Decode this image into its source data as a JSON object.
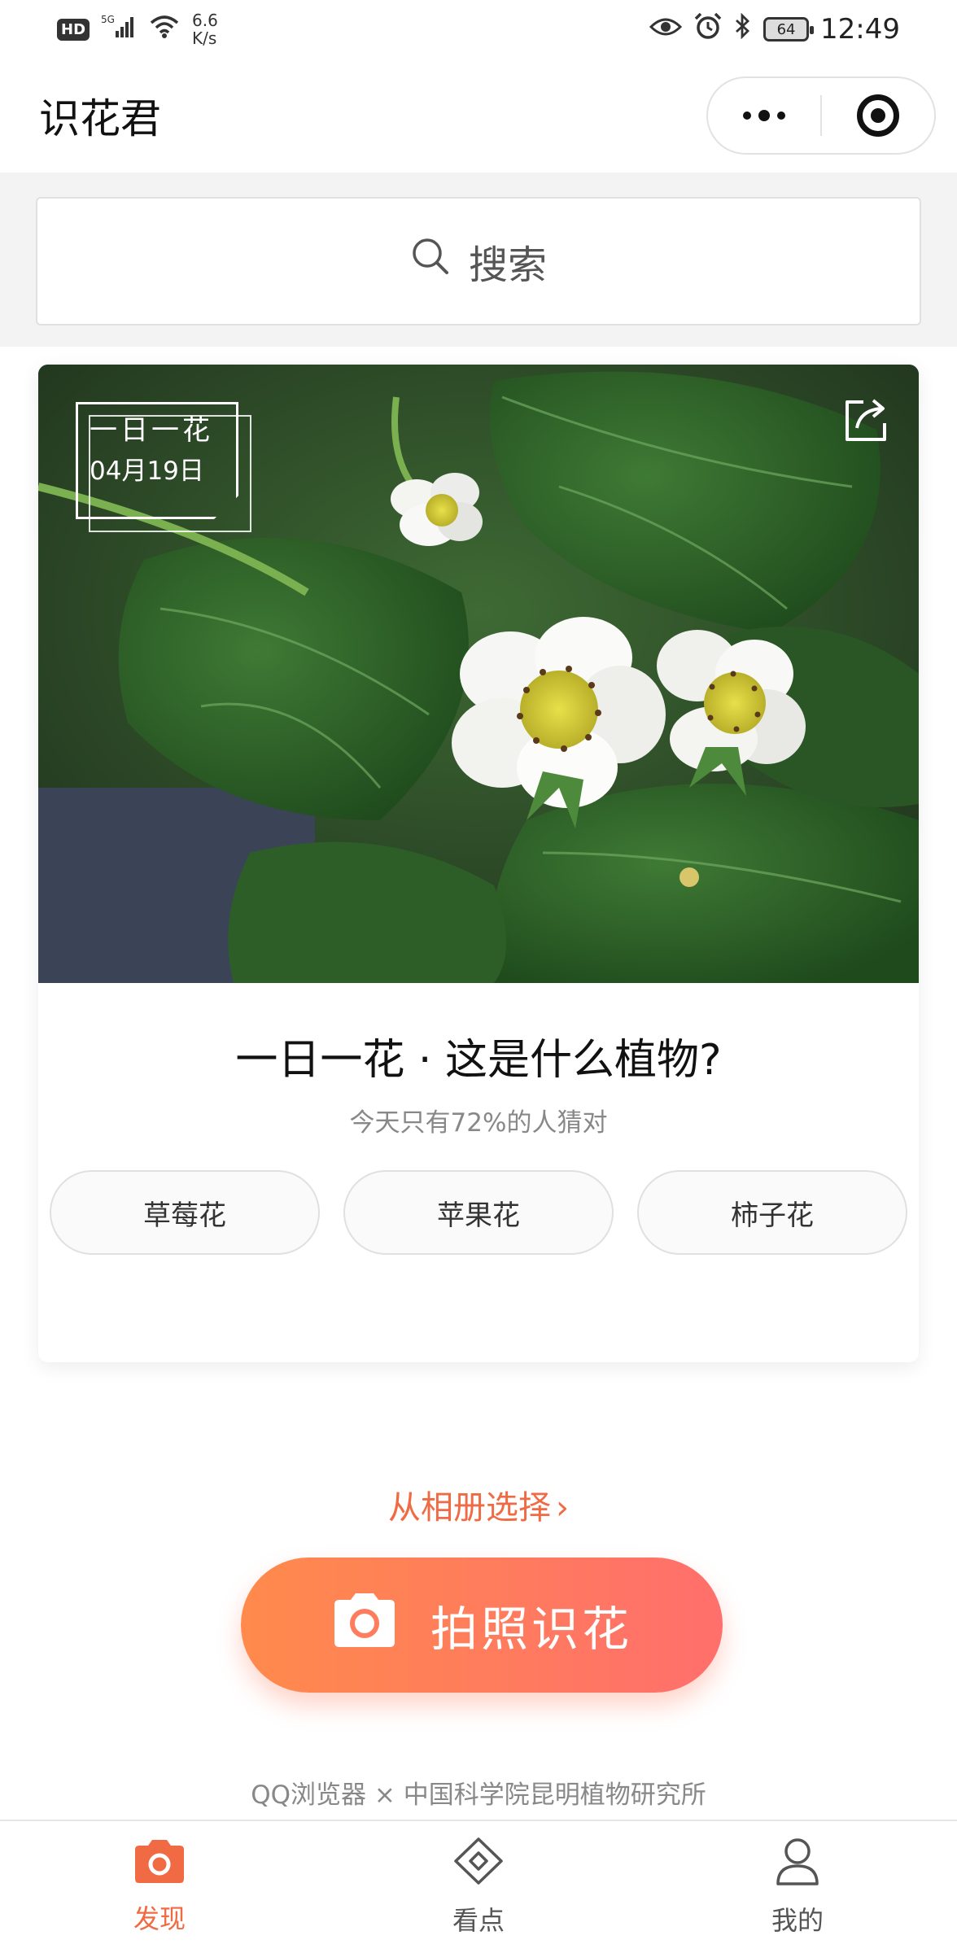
{
  "status_bar": {
    "hd": "HD",
    "network": "5G",
    "speed_value": "6.6",
    "speed_unit": "K/s",
    "battery": "64",
    "time": "12:49"
  },
  "header": {
    "title": "识花君",
    "more_icon": "more-dots-icon",
    "close_icon": "target-circle-icon"
  },
  "search": {
    "placeholder": "搜索",
    "icon": "search-icon"
  },
  "daily_card": {
    "tag_title": "一日一花",
    "tag_date": "04月19日",
    "question": "一日一花 · 这是什么植物?",
    "hint": "今天只有72%的人猜对",
    "options": [
      "草莓花",
      "苹果花",
      "柿子花"
    ],
    "share_icon": "share-icon",
    "photo": "strawberry-blossom-photo"
  },
  "actions": {
    "album_label": "从相册选择",
    "album_chevron": "›",
    "camera_label": "拍照识花",
    "camera_icon": "camera-icon"
  },
  "credit": "QQ浏览器 × 中国科学院昆明植物研究所",
  "tabs": [
    {
      "label": "发现",
      "icon": "camera-icon",
      "active": true
    },
    {
      "label": "看点",
      "icon": "diamond-icon",
      "active": false
    },
    {
      "label": "我的",
      "icon": "user-icon",
      "active": false
    }
  ],
  "colors": {
    "accent": "#f06a43",
    "button_start": "#ff8a4c",
    "button_end": "#ff6f6c"
  }
}
